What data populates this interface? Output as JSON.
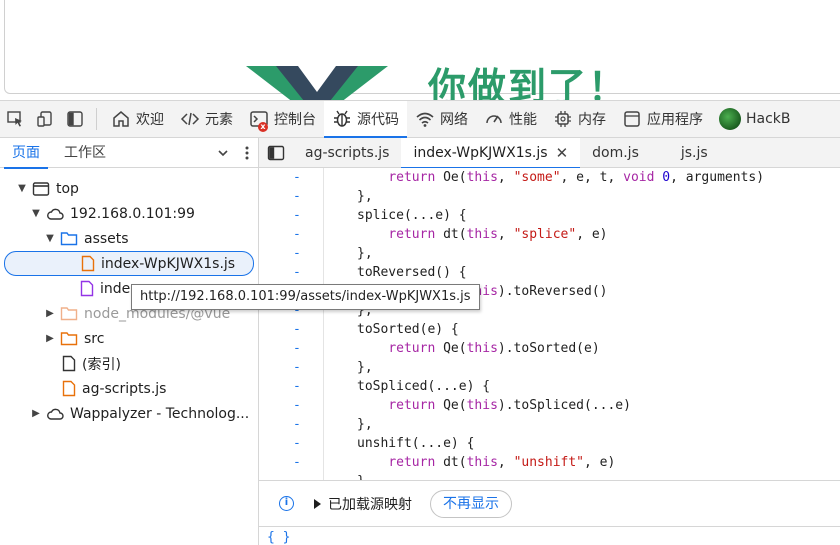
{
  "webpage": {
    "hero_title": "你做到了！"
  },
  "toolbar": {
    "tabs": [
      {
        "label": "欢迎",
        "icon": "home-icon"
      },
      {
        "label": "元素",
        "icon": "code-icon"
      },
      {
        "label": "控制台",
        "icon": "console-icon"
      },
      {
        "label": "源代码",
        "icon": "bug-icon"
      },
      {
        "label": "网络",
        "icon": "wifi-icon"
      },
      {
        "label": "性能",
        "icon": "gauge-icon"
      },
      {
        "label": "内存",
        "icon": "chip-icon"
      },
      {
        "label": "应用程序",
        "icon": "app-icon"
      },
      {
        "label": "HackB",
        "icon": "hackbar-avatar-icon"
      }
    ],
    "active_tab": "源代码",
    "console_error_badge": "x"
  },
  "left_panel": {
    "tabs": [
      "页面",
      "工作区"
    ],
    "active_tab": "页面",
    "tree": [
      {
        "label": "top"
      },
      {
        "label": "192.168.0.101:99"
      },
      {
        "label": "assets"
      },
      {
        "label": "index-WpKJWX1s.js"
      },
      {
        "label": "inde"
      },
      {
        "label": "node_modules/@vue"
      },
      {
        "label": "src"
      },
      {
        "label": "(索引)"
      },
      {
        "label": "ag-scripts.js"
      },
      {
        "label": "Wappalyzer - Technolog..."
      }
    ]
  },
  "tooltip": {
    "text": "http://192.168.0.101:99/assets/index-WpKJWX1s.js"
  },
  "file_tabs": [
    {
      "label": "ag-scripts.js"
    },
    {
      "label": "index-WpKJWX1s.js",
      "close": "✕"
    },
    {
      "label": "dom.js"
    },
    {
      "label": "js.js"
    }
  ],
  "active_file": "index-WpKJWX1s.js",
  "code_lines": [
    {
      "marker": "-",
      "text": "        return Oe(this, \"some\", e, t, void 0, arguments)"
    },
    {
      "marker": "-",
      "text": "    },"
    },
    {
      "marker": "-",
      "text": "    splice(...e) {"
    },
    {
      "marker": "-",
      "text": "        return dt(this, \"splice\", e)"
    },
    {
      "marker": "-",
      "text": "    },"
    },
    {
      "marker": "-",
      "text": "    toReversed() {"
    },
    {
      "marker": "-",
      "text": "        return Qe(this).toReversed()"
    },
    {
      "marker": "-",
      "text": "    },"
    },
    {
      "marker": "-",
      "text": "    toSorted(e) {"
    },
    {
      "marker": "-",
      "text": "        return Qe(this).toSorted(e)"
    },
    {
      "marker": "-",
      "text": "    },"
    },
    {
      "marker": "-",
      "text": "    toSpliced(...e) {"
    },
    {
      "marker": "-",
      "text": "        return Qe(this).toSpliced(...e)"
    },
    {
      "marker": "-",
      "text": "    },"
    },
    {
      "marker": "-",
      "text": "    unshift(...e) {"
    },
    {
      "marker": "-",
      "text": "        return dt(this, \"unshift\", e)"
    },
    {
      "marker": "-",
      "text": "    }"
    }
  ],
  "bottom_bar": {
    "source_map_label": "已加载源映射",
    "dismiss_label": "不再显示"
  },
  "format_button": "{ }",
  "colors": {
    "accent": "#1a73e8",
    "vue_green": "#2c9b6a",
    "selected_bg": "#eaf1fb",
    "toolbar_bg": "#f3f3f3"
  }
}
